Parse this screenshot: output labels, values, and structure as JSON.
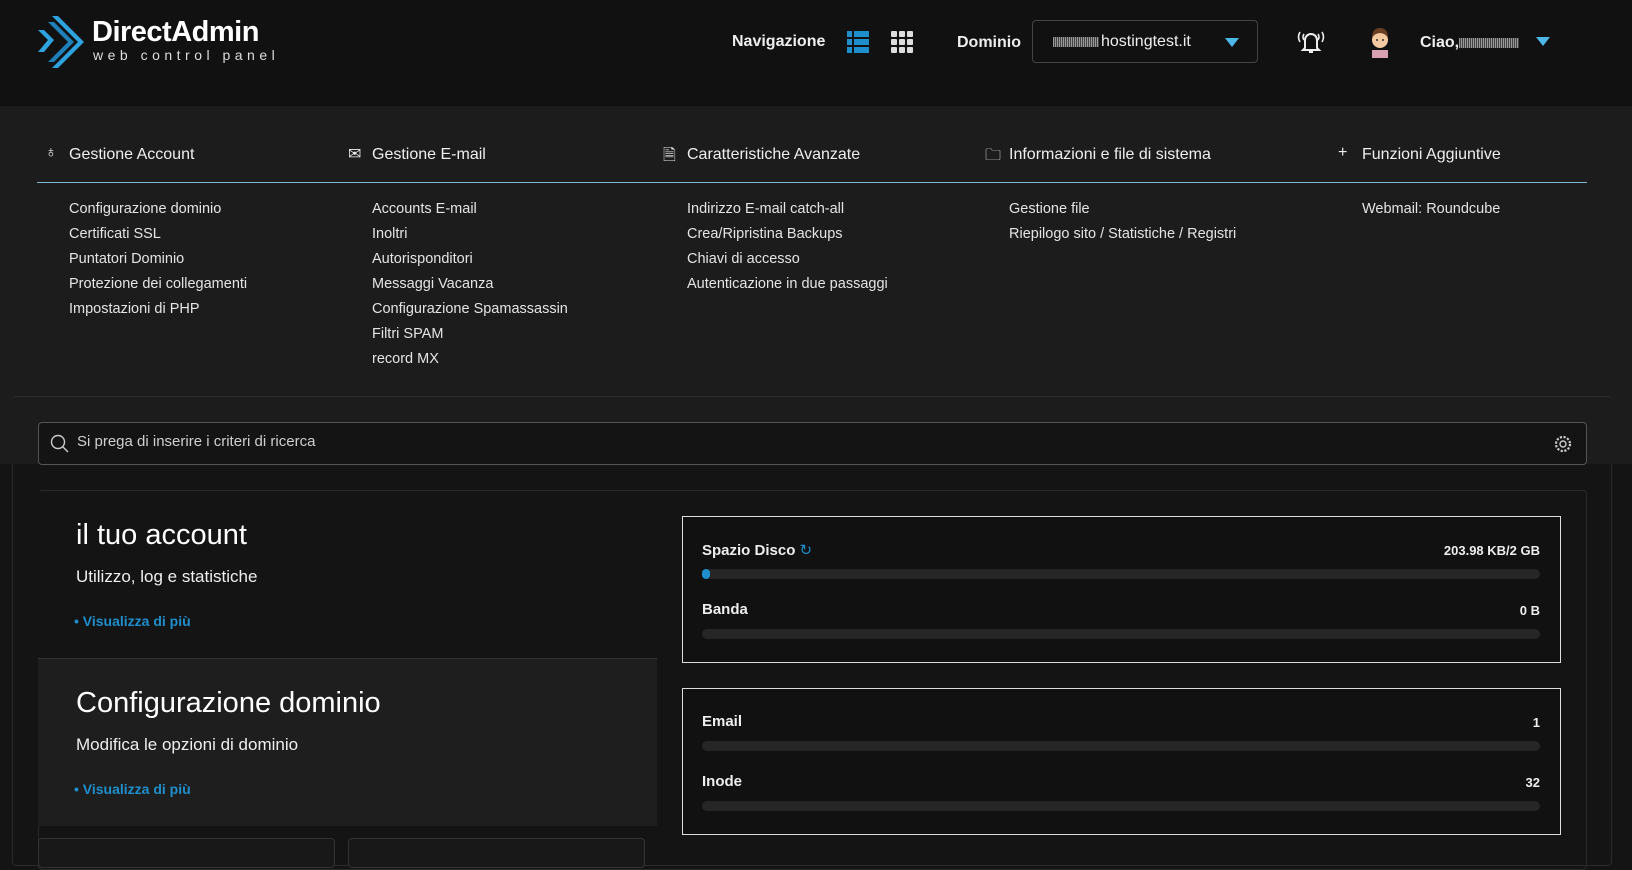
{
  "header": {
    "logo_title": "DirectAdmin",
    "logo_subtitle": "web control panel",
    "nav_label": "Navigazione",
    "domain_label": "Dominio",
    "domain_value": "hostingtest.it",
    "greeting": "Ciao,",
    "accent": "#1e8fcc"
  },
  "menu": {
    "columns": [
      {
        "title": "Gestione Account",
        "icon": "user-icon",
        "items": [
          "Configurazione dominio",
          "Certificati SSL",
          "Puntatori Dominio",
          "Protezione dei collegamenti",
          "Impostazioni di PHP"
        ]
      },
      {
        "title": "Gestione E-mail",
        "icon": "mail-icon",
        "items": [
          "Accounts E-mail",
          "Inoltri",
          "Autorisponditori",
          "Messaggi Vacanza",
          "Configurazione Spamassassin",
          "Filtri SPAM",
          "record MX"
        ]
      },
      {
        "title": "Caratteristiche Avanzate",
        "icon": "file-gear-icon",
        "items": [
          "Indirizzo E-mail catch-all",
          "Crea/Ripristina Backups",
          "Chiavi di accesso",
          "Autenticazione in due passaggi"
        ]
      },
      {
        "title": "Informazioni e file di sistema",
        "icon": "folder-icon",
        "items": [
          "Gestione file",
          "Riepilogo sito / Statistiche / Registri"
        ]
      },
      {
        "title": "Funzioni Aggiuntive",
        "icon": "plus-icon",
        "items": [
          "Webmail: Roundcube"
        ]
      }
    ]
  },
  "search": {
    "placeholder": "Si prega di inserire i criteri di ricerca"
  },
  "cards": [
    {
      "title": "il tuo account",
      "subtitle": "Utilizzo, log e statistiche",
      "link": "• Visualizza di più"
    },
    {
      "title": "Configurazione dominio",
      "subtitle": "Modifica le opzioni di dominio",
      "link": "• Visualizza di più"
    }
  ],
  "stats": [
    {
      "label": "Spazio Disco",
      "value": "203.98 KB/2 GB",
      "percent": 0.01
    },
    {
      "label": "Banda",
      "value": "0 B",
      "percent": 0
    },
    {
      "label": "Email",
      "value": "1",
      "percent": 0
    },
    {
      "label": "Inode",
      "value": "32",
      "percent": 0
    }
  ]
}
